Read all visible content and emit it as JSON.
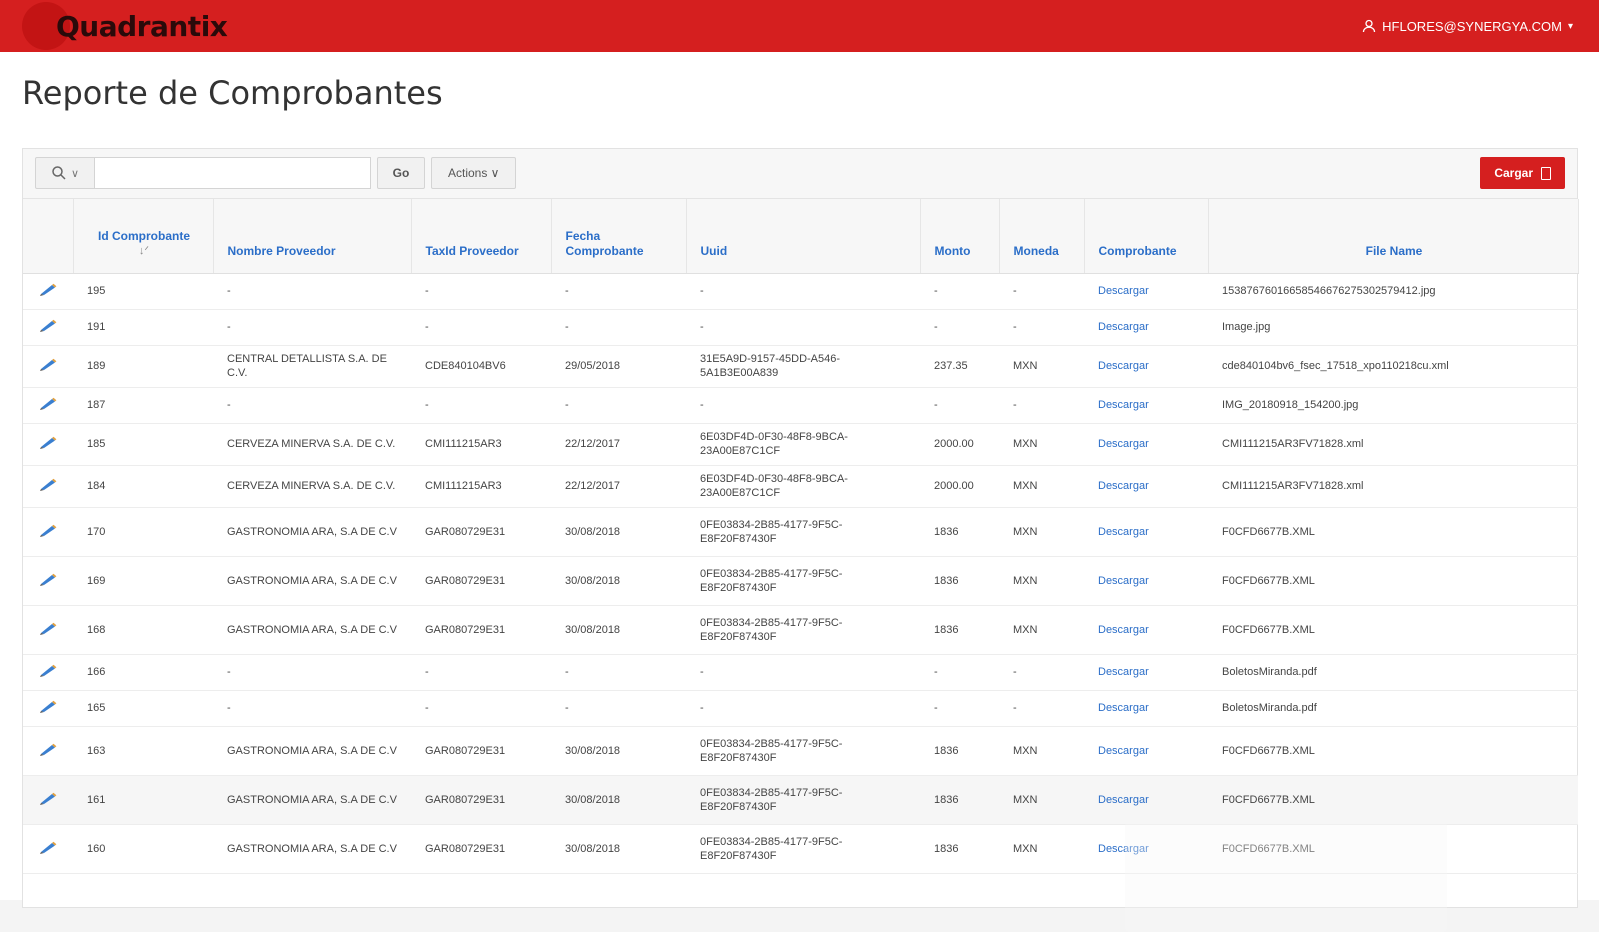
{
  "header": {
    "brand": "Quadrantix",
    "user_email": "HFLORES@SYNERGYA.COM",
    "user_caret": "▾"
  },
  "page": {
    "title": "Reporte de Comprobantes"
  },
  "toolbar": {
    "search_icon": "⚲",
    "search_caret": "∨",
    "search_placeholder": "",
    "go_label": "Go",
    "actions_label": "Actions ∨",
    "cargar_label": "Cargar"
  },
  "table": {
    "columns": [
      {
        "label": "Id Comprobante",
        "sort": "↓ᐟ"
      },
      {
        "label": "Nombre Proveedor"
      },
      {
        "label": "TaxId Proveedor"
      },
      {
        "label": "Fecha Comprobante"
      },
      {
        "label": "Uuid"
      },
      {
        "label": "Monto"
      },
      {
        "label": "Moneda"
      },
      {
        "label": "Comprobante"
      },
      {
        "label": "File Name"
      }
    ],
    "rows": [
      {
        "id": "195",
        "nombre": "-",
        "taxid": "-",
        "fecha": "-",
        "uuid": "-",
        "monto": "-",
        "moneda": "-",
        "comprobante": "Descargar",
        "file": "15387676016658546676275302579412.jpg"
      },
      {
        "id": "191",
        "nombre": "-",
        "taxid": "-",
        "fecha": "-",
        "uuid": "-",
        "monto": "-",
        "moneda": "-",
        "comprobante": "Descargar",
        "file": "Image.jpg"
      },
      {
        "id": "189",
        "nombre": "CENTRAL DETALLISTA S.A. DE C.V.",
        "taxid": "CDE840104BV6",
        "fecha": "29/05/2018",
        "uuid": "31E5A9D-9157-45DD-A546-5A1B3E00A839",
        "monto": "237.35",
        "moneda": "MXN",
        "comprobante": "Descargar",
        "file": "cde840104bv6_fsec_17518_xpo110218cu.xml"
      },
      {
        "id": "187",
        "nombre": "-",
        "taxid": "-",
        "fecha": "-",
        "uuid": "-",
        "monto": "-",
        "moneda": "-",
        "comprobante": "Descargar",
        "file": "IMG_20180918_154200.jpg"
      },
      {
        "id": "185",
        "nombre": "CERVEZA MINERVA S.A. DE C.V.",
        "taxid": "CMI111215AR3",
        "fecha": "22/12/2017",
        "uuid": "6E03DF4D-0F30-48F8-9BCA-23A00E87C1CF",
        "monto": "2000.00",
        "moneda": "MXN",
        "comprobante": "Descargar",
        "file": "CMI111215AR3FV71828.xml"
      },
      {
        "id": "184",
        "nombre": "CERVEZA MINERVA S.A. DE C.V.",
        "taxid": "CMI111215AR3",
        "fecha": "22/12/2017",
        "uuid": "6E03DF4D-0F30-48F8-9BCA-23A00E87C1CF",
        "monto": "2000.00",
        "moneda": "MXN",
        "comprobante": "Descargar",
        "file": "CMI111215AR3FV71828.xml"
      },
      {
        "id": "170",
        "nombre": "GASTRONOMIA ARA, S.A DE C.V",
        "taxid": "GAR080729E31",
        "fecha": "30/08/2018",
        "uuid": "0FE03834-2B85-4177-9F5C-E8F20F87430F",
        "monto": "1836",
        "moneda": "MXN",
        "comprobante": "Descargar",
        "file": "F0CFD6677B.XML"
      },
      {
        "id": "169",
        "nombre": "GASTRONOMIA ARA, S.A DE C.V",
        "taxid": "GAR080729E31",
        "fecha": "30/08/2018",
        "uuid": "0FE03834-2B85-4177-9F5C-E8F20F87430F",
        "monto": "1836",
        "moneda": "MXN",
        "comprobante": "Descargar",
        "file": "F0CFD6677B.XML"
      },
      {
        "id": "168",
        "nombre": "GASTRONOMIA ARA, S.A DE C.V",
        "taxid": "GAR080729E31",
        "fecha": "30/08/2018",
        "uuid": "0FE03834-2B85-4177-9F5C-E8F20F87430F",
        "monto": "1836",
        "moneda": "MXN",
        "comprobante": "Descargar",
        "file": "F0CFD6677B.XML"
      },
      {
        "id": "166",
        "nombre": "-",
        "taxid": "-",
        "fecha": "-",
        "uuid": "-",
        "monto": "-",
        "moneda": "-",
        "comprobante": "Descargar",
        "file": "BoletosMiranda.pdf"
      },
      {
        "id": "165",
        "nombre": "-",
        "taxid": "-",
        "fecha": "-",
        "uuid": "-",
        "monto": "-",
        "moneda": "-",
        "comprobante": "Descargar",
        "file": "BoletosMiranda.pdf"
      },
      {
        "id": "163",
        "nombre": "GASTRONOMIA ARA, S.A DE C.V",
        "taxid": "GAR080729E31",
        "fecha": "30/08/2018",
        "uuid": "0FE03834-2B85-4177-9F5C-E8F20F87430F",
        "monto": "1836",
        "moneda": "MXN",
        "comprobante": "Descargar",
        "file": "F0CFD6677B.XML"
      },
      {
        "id": "161",
        "nombre": "GASTRONOMIA ARA, S.A DE C.V",
        "taxid": "GAR080729E31",
        "fecha": "30/08/2018",
        "uuid": "0FE03834-2B85-4177-9F5C-E8F20F87430F",
        "monto": "1836",
        "moneda": "MXN",
        "comprobante": "Descargar",
        "file": "F0CFD6677B.XML"
      },
      {
        "id": "160",
        "nombre": "GASTRONOMIA ARA, S.A DE C.V",
        "taxid": "GAR080729E31",
        "fecha": "30/08/2018",
        "uuid": "0FE03834-2B85-4177-9F5C-E8F20F87430F",
        "monto": "1836",
        "moneda": "MXN",
        "comprobante": "Descargar",
        "file": "F0CFD6677B.XML"
      }
    ]
  },
  "colors": {
    "brand_red": "#d51f1f",
    "link_blue": "#2b6ec8"
  }
}
